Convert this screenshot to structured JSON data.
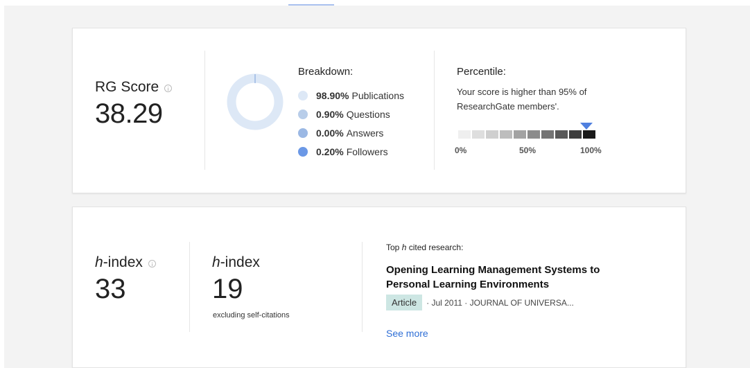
{
  "rg": {
    "label": "RG Score",
    "value": "38.29",
    "info_icon": "info-icon"
  },
  "breakdown": {
    "title": "Breakdown:",
    "items": [
      {
        "percent": "98.90%",
        "label": "Publications",
        "color": "#dde8f6",
        "share": 0.989
      },
      {
        "percent": "0.90%",
        "label": "Questions",
        "color": "#b8cde9",
        "share": 0.009
      },
      {
        "percent": "0.00%",
        "label": "Answers",
        "color": "#9bb8e4",
        "share": 0.0
      },
      {
        "percent": "0.20%",
        "label": "Followers",
        "color": "#6b98e6",
        "share": 0.002
      }
    ]
  },
  "percentile": {
    "title": "Percentile:",
    "description": "Your score is higher than 95% of ResearchGate members'.",
    "value": 95,
    "ticks": [
      "0%",
      "50%",
      "100%"
    ],
    "scale_colors": [
      "#efefef",
      "#dedede",
      "#cfcfcf",
      "#bdbdbd",
      "#a3a3a3",
      "#8c8c8c",
      "#747474",
      "#595959",
      "#3d3d3d",
      "#1a1a1a"
    ],
    "marker_color": "#4f7fdf"
  },
  "hindex": {
    "label_italic": "h",
    "label_rest": "-index",
    "value": "33"
  },
  "hindex_excl": {
    "label_italic": "h",
    "label_rest": "-index",
    "value": "19",
    "note": "excluding self-citations"
  },
  "top_cited": {
    "title_prefix": "Top ",
    "title_italic": "h",
    "title_suffix": " cited research:",
    "paper_title": "Opening Learning Management Systems to Personal Learning Environments",
    "badge": "Article",
    "meta": "· Jul 2011 · JOURNAL OF UNIVERSA...",
    "see_more": "See more"
  }
}
